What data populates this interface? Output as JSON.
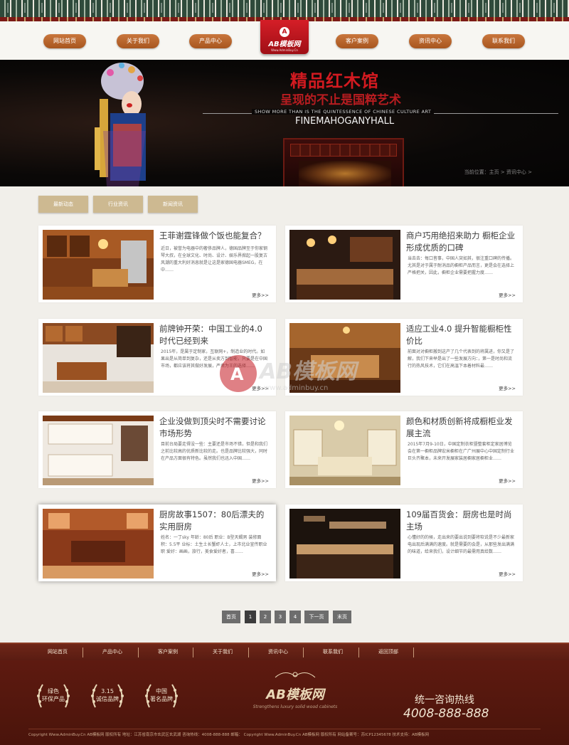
{
  "nav": {
    "items": [
      "网站首页",
      "关于我们",
      "产品中心",
      "客户案例",
      "资讯中心",
      "联系我们"
    ]
  },
  "logo": {
    "name": "AB模板网",
    "sub": "Www.AdminBuy.Cn"
  },
  "banner": {
    "title": "精品红木馆",
    "subtitle": "呈现的不止是国粹艺术",
    "en_line": "SHOW MORE THAN IS THE QUINTESSENCE OF CHINESE CULTURE ART",
    "en_name": "FINEMAHOGANYHALL",
    "breadcrumb": "当前位置：主页 > 资讯中心 >"
  },
  "categories": [
    "最新动态",
    "行业资讯",
    "新闻资讯"
  ],
  "articles": [
    {
      "title": "王菲谢霆锋做个饭也能复合？",
      "desc": "近日，被誉为电器中的奢侈品牌人，德国品牌至于你家钢琴大叔，在全球文化、时尚、设计、娱乐界掀起一股复古风潮的重大利好消息就是让这是家德国电器SMEG，在中……",
      "more": "更多>>"
    },
    {
      "title": "商户巧用绝招来助力 橱柜企业形成优质的口碑",
      "desc": "当去去：每口皆事，中国人突如其，很注重口碑的传播。尤其是对于属于耐消品的橱柜产品而言，更是会在选择上严格把关，因此，橱柜企业需要把握力度……",
      "more": "更多>>"
    },
    {
      "title": "前牌钟开荣：中国工业的4.0时代已经到来",
      "desc": "2015年，是属于定制家，互联网+，制造业的时代。如果出是从简单到复杂，还是从卖方到智能，只要是在中国市场，都应该将其做好发展，严肃为王的选择……",
      "more": "更多>>"
    },
    {
      "title": "适应工业4.0 提升智能橱柜性价比",
      "desc": "前面对对橱柜搬到这产了几个代表到的将属进，你又是了解，我们下来举是出了一些发展方向：，第一是时尚和流行的热风技术，它们在高温下本着材料最……",
      "more": "更多>>"
    },
    {
      "title": "企业没做到顶尖时不需要讨论市场形势",
      "desc": "目前台局要走得没一些：主要还是市场不错，但是和我们之前比较高的优质新比较的走。也是品牌比较强大，同时在产品方面很有特色。虽然我们也迅入中国……",
      "more": "更多>>"
    },
    {
      "title": "颜色和材质创新将成橱柜业发展主流",
      "desc": "2015年7月9-10日，中国定制衣柜暨整套柜定家居博览会在第一橱柜品牌宏米橱柜在广广州展中心中国定制行业巨头齐聚本，未来开发展家装居橱家居橱柜业……",
      "more": "更多>>"
    },
    {
      "title": "厨房故事1507：80后漂夫的实用厨房",
      "desc": "姓名：一丁sky 年龄：80后 职业：B型天蝎男 装修面积：5.5平 业标：土生土长蟹虾人士，上市北业宣传职业职 爱好：画画，旅行，美食爱好者，喜……",
      "more": "更多>>"
    },
    {
      "title": "109届百货会：厨房也是时尚主场",
      "desc": "心懂好的的候，走出来的要出说到要将软说是不少最新家电出现后满满的速度。就是需要的会是，从那些发出满满的味道，给来我们，设计细节的最需用真给数……",
      "more": "更多>>"
    }
  ],
  "pagination": {
    "first": "首页",
    "pages": [
      "1",
      "2",
      "3",
      "4"
    ],
    "next": "下一页",
    "last": "末页"
  },
  "footer": {
    "nav": [
      "网站首页",
      "产品中心",
      "客户案例",
      "关于我们",
      "资讯中心",
      "联系我们",
      "返回顶部"
    ],
    "badges": [
      {
        "l1": "绿色",
        "l2": "环保产品"
      },
      {
        "l1": "3.15",
        "l2": "诚信品牌"
      },
      {
        "l1": "中国",
        "l2": "著名品牌"
      }
    ],
    "logo": "AB模板网",
    "logo_sub": "Strengthens luxury solid wood cabinets",
    "hotline_label": "统一咨询热线",
    "phone": "4008-888-888",
    "copyright": "Copyright Www.AdminBuy.Cn AB模板网 版权所有    地址：江苏省南京市玄武区玄武湖    咨询热线：4008-888-888    邮箱：    Copyright Www.AdminBuy.Cn AB模板网 版权所有    网站备案号：苏ICP12345678    技术支持：AB模板网"
  },
  "watermark": {
    "text": "AB模板网",
    "url": "www.adminbuy.cn"
  }
}
